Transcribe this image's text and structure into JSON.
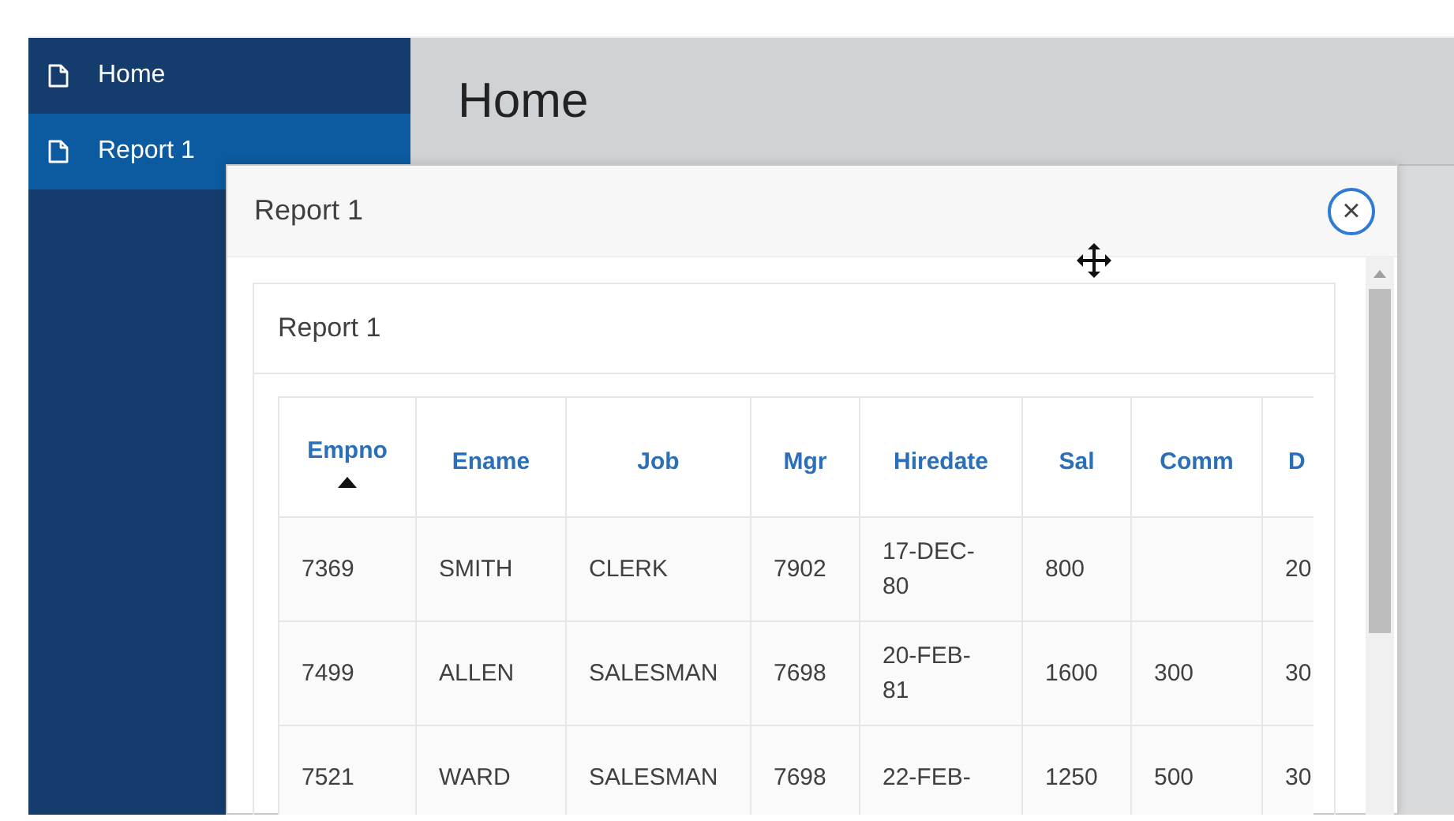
{
  "sidebar": {
    "items": [
      {
        "label": "Home",
        "selected": false
      },
      {
        "label": "Report 1",
        "selected": true
      }
    ]
  },
  "page": {
    "title": "Home"
  },
  "dialog": {
    "title": "Report 1",
    "close_label": "×",
    "region": {
      "title": "Report 1",
      "table": {
        "columns": [
          {
            "label": "Empno",
            "sorted": true
          },
          {
            "label": "Ename",
            "sorted": false
          },
          {
            "label": "Job",
            "sorted": false
          },
          {
            "label": "Mgr",
            "sorted": false
          },
          {
            "label": "Hiredate",
            "sorted": false
          },
          {
            "label": "Sal",
            "sorted": false
          },
          {
            "label": "Comm",
            "sorted": false
          },
          {
            "label": "D",
            "sorted": false
          }
        ],
        "rows": [
          [
            "7369",
            "SMITH",
            "CLERK",
            "7902",
            "17-DEC-80",
            "800",
            "",
            "20"
          ],
          [
            "7499",
            "ALLEN",
            "SALESMAN",
            "7698",
            "20-FEB-81",
            "1600",
            "300",
            "30"
          ],
          [
            "7521",
            "WARD",
            "SALESMAN",
            "7698",
            "22-FEB-",
            "1250",
            "500",
            "30"
          ]
        ]
      }
    }
  }
}
